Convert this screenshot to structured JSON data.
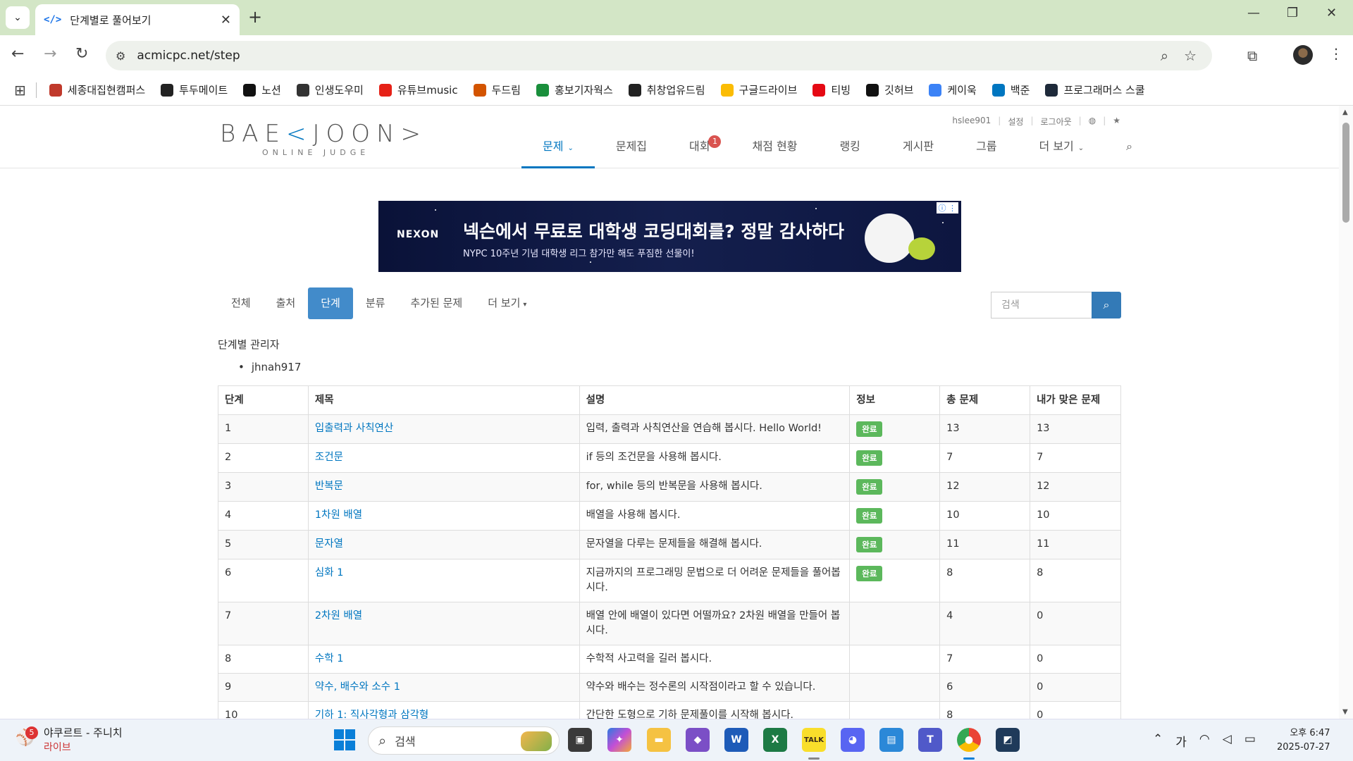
{
  "browser": {
    "tab_title": "단계별로 풀어보기",
    "tab_favicon": "</>",
    "url": "acmicpc.net/step",
    "bookmarks": [
      {
        "label": "세종대집현캠퍼스",
        "color": "#c0392b",
        "icon": "sejong-icon"
      },
      {
        "label": "투두메이트",
        "color": "#222222",
        "icon": "todomate-icon"
      },
      {
        "label": "노션",
        "color": "#111111",
        "icon": "notion-icon"
      },
      {
        "label": "인생도우미",
        "color": "#333333",
        "icon": "openai-icon"
      },
      {
        "label": "유튜브music",
        "color": "#e62117",
        "icon": "youtube-music-icon"
      },
      {
        "label": "두드림",
        "color": "#d35400",
        "icon": "dodream-icon"
      },
      {
        "label": "홍보기자웍스",
        "color": "#1a8f3c",
        "icon": "works-icon"
      },
      {
        "label": "취창업유드림",
        "color": "#222222",
        "icon": "globe-icon"
      },
      {
        "label": "구글드라이브",
        "color": "#fbbc04",
        "icon": "google-drive-icon"
      },
      {
        "label": "티빙",
        "color": "#e50914",
        "icon": "tving-icon"
      },
      {
        "label": "깃허브",
        "color": "#111111",
        "icon": "github-icon"
      },
      {
        "label": "케이욱",
        "color": "#3b82f6",
        "icon": "infinity-icon"
      },
      {
        "label": "백준",
        "color": "#0076c0",
        "icon": "baekjoon-icon"
      },
      {
        "label": "프로그래머스 스쿨",
        "color": "#1e2a3a",
        "icon": "programmers-icon"
      }
    ]
  },
  "header": {
    "logo_text_left": "BAE",
    "logo_text_k": "<",
    "logo_text_right": "JOON>",
    "logo_sub": "ONLINE JUDGE",
    "user_menu": [
      "hslee901",
      "설정",
      "로그아웃"
    ],
    "nav": [
      {
        "label": "문제",
        "active": true,
        "caret": true
      },
      {
        "label": "문제집"
      },
      {
        "label": "대회",
        "badge": "1"
      },
      {
        "label": "채점 현황"
      },
      {
        "label": "랭킹"
      },
      {
        "label": "게시판"
      },
      {
        "label": "그룹"
      },
      {
        "label": "더 보기",
        "caret": true
      }
    ]
  },
  "ad": {
    "brand": "NEXON",
    "headline": "넥슨에서 무료로 대학생 코딩대회를? 정말 감사하다",
    "subline": "NYPC 10주년 기념 대학생 리그 참가만 해도 푸짐한 선물이!"
  },
  "subnav": {
    "items": [
      "전체",
      "출처",
      "단계",
      "분류",
      "추가된 문제",
      "더 보기"
    ],
    "active_index": 2,
    "search_placeholder": "검색"
  },
  "managers": {
    "title": "단계별 관리자",
    "list": [
      "jhnah917"
    ]
  },
  "table": {
    "headers": [
      "단계",
      "제목",
      "설명",
      "정보",
      "총 문제",
      "내가 맞은 문제"
    ],
    "rows": [
      {
        "step": "1",
        "title": "입출력과 사칙연산",
        "desc": "입력, 출력과 사칙연산을 연습해 봅시다. Hello World!",
        "info": "완료",
        "total": "13",
        "solved": "13"
      },
      {
        "step": "2",
        "title": "조건문",
        "desc": "if 등의 조건문을 사용해 봅시다.",
        "info": "완료",
        "total": "7",
        "solved": "7"
      },
      {
        "step": "3",
        "title": "반복문",
        "desc": "for, while 등의 반복문을 사용해 봅시다.",
        "info": "완료",
        "total": "12",
        "solved": "12"
      },
      {
        "step": "4",
        "title": "1차원 배열",
        "desc": "배열을 사용해 봅시다.",
        "info": "완료",
        "total": "10",
        "solved": "10"
      },
      {
        "step": "5",
        "title": "문자열",
        "desc": "문자열을 다루는 문제들을 해결해 봅시다.",
        "info": "완료",
        "total": "11",
        "solved": "11"
      },
      {
        "step": "6",
        "title": "심화 1",
        "desc": "지금까지의 프로그래밍 문법으로 더 어려운 문제들을 풀어봅시다.",
        "info": "완료",
        "total": "8",
        "solved": "8"
      },
      {
        "step": "7",
        "title": "2차원 배열",
        "desc": "배열 안에 배열이 있다면 어떨까요? 2차원 배열을 만들어 봅시다.",
        "info": "",
        "total": "4",
        "solved": "0"
      },
      {
        "step": "8",
        "title": "수학 1",
        "desc": "수학적 사고력을 길러 봅시다.",
        "info": "",
        "total": "7",
        "solved": "0"
      },
      {
        "step": "9",
        "title": "약수, 배수와 소수 1",
        "desc": "약수와 배수는 정수론의 시작점이라고 할 수 있습니다.",
        "info": "",
        "total": "6",
        "solved": "0"
      },
      {
        "step": "10",
        "title": "기하 1: 직사각형과 삼각형",
        "desc": "간단한 도형으로 기하 문제풀이를 시작해 봅시다.",
        "info": "",
        "total": "8",
        "solved": "0"
      }
    ]
  },
  "taskbar": {
    "weather_badge": "5",
    "weather_title": "야쿠르트 - 주니치",
    "weather_sub": "라이브",
    "search_label": "검색",
    "ime": "가",
    "time": "오후 6:47",
    "date": "2025-07-27"
  }
}
